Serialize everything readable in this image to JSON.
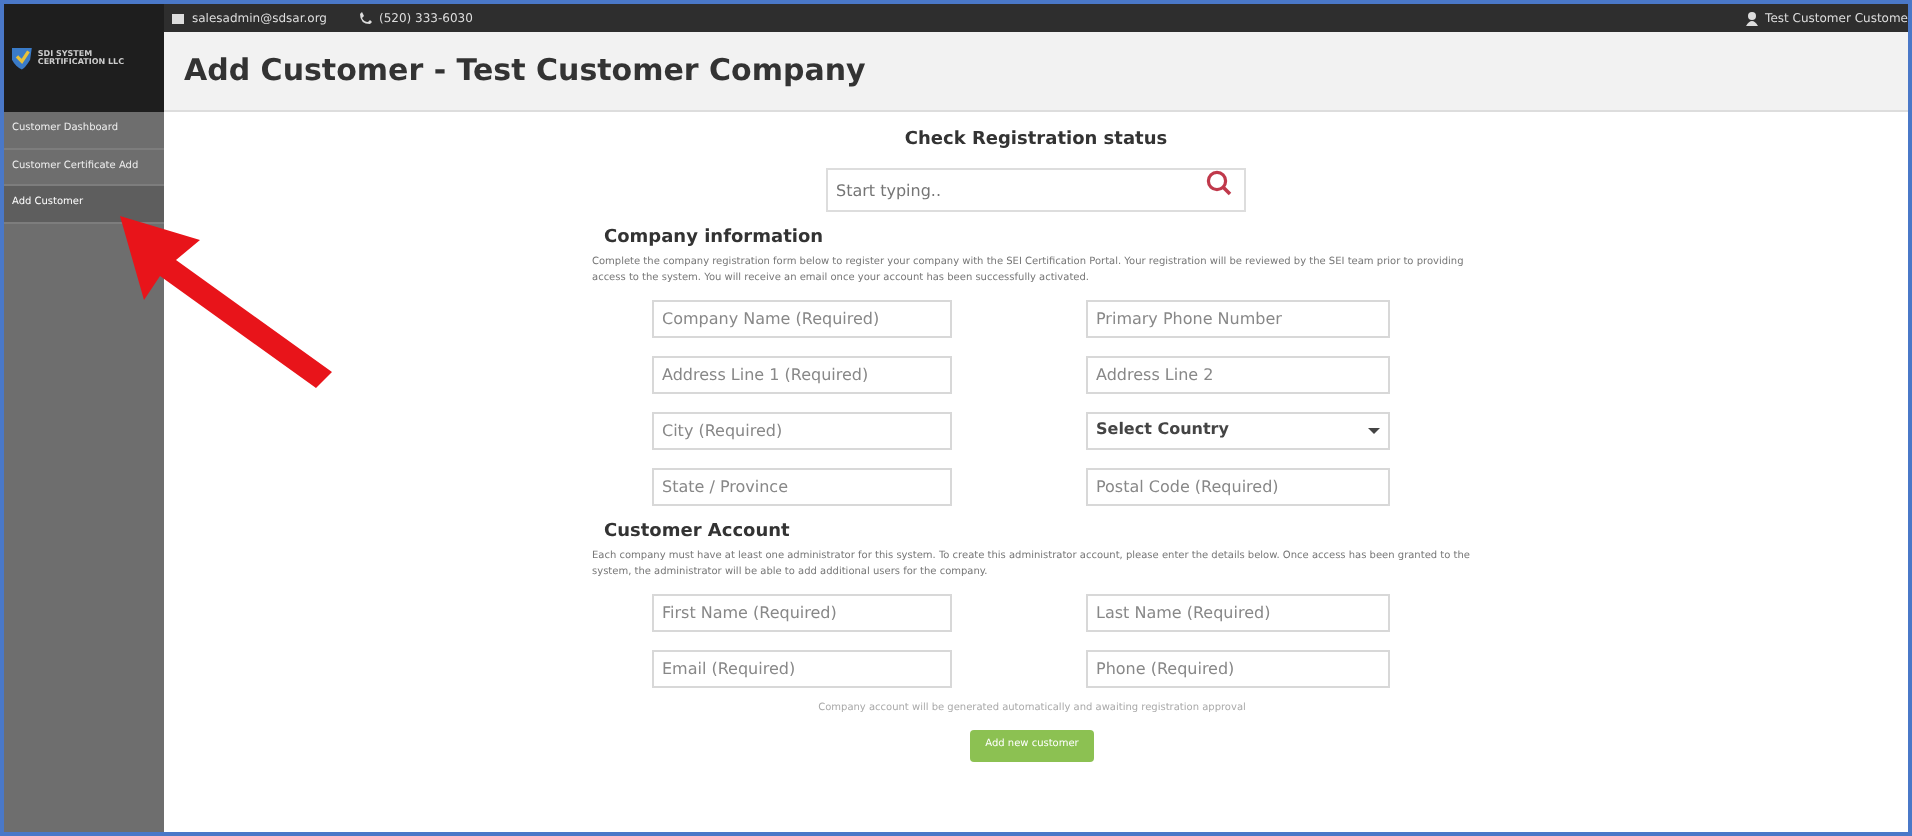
{
  "top_bar": {
    "email": "salesadmin@sdsar.org",
    "phone": "(520) 333-6030",
    "user": "Test Customer Custome"
  },
  "logo": {
    "text": "SDI SYSTEM CERTIFICATION LLC"
  },
  "sidebar": {
    "items": [
      {
        "label": "Customer Dashboard",
        "selected": false
      },
      {
        "label": "Customer Certificate Add",
        "selected": false
      },
      {
        "label": "Add Customer",
        "selected": true
      }
    ]
  },
  "page_title": "Add Customer - Test Customer Company",
  "registration_check": {
    "title": "Check Registration status",
    "placeholder": "Start typing.."
  },
  "sections": [
    {
      "title": "Company information",
      "description": "Complete the company registration form below to register your company with the SEI Certification Portal. Your registration will be reviewed by the SEI team prior to providing access to the system. You will receive an email once your account has been successfully activated.",
      "fields": [
        {
          "kind": "input",
          "placeholder": "Company Name (Required)"
        },
        {
          "kind": "input",
          "placeholder": "Primary Phone Number"
        },
        {
          "kind": "input",
          "placeholder": "Address Line 1 (Required)"
        },
        {
          "kind": "input",
          "placeholder": "Address Line 2"
        },
        {
          "kind": "input",
          "placeholder": "City (Required)"
        },
        {
          "kind": "select",
          "value": "Select Country"
        },
        {
          "kind": "input",
          "placeholder": "State / Province"
        },
        {
          "kind": "input",
          "placeholder": "Postal Code (Required)"
        }
      ]
    },
    {
      "title": "Customer Account",
      "description": "Each company must have at least one administrator for this system. To create this administrator account, please enter the details below. Once access has been granted to the system, the administrator will be able to add additional users for the company.",
      "fields": [
        {
          "kind": "input",
          "placeholder": "First Name (Required)"
        },
        {
          "kind": "input",
          "placeholder": "Last Name (Required)"
        },
        {
          "kind": "input",
          "placeholder": "Email (Required)"
        },
        {
          "kind": "input",
          "placeholder": "Phone (Required)"
        }
      ]
    }
  ],
  "note": "Company account will be generated automatically and awaiting registration approval",
  "submit_button": "Add new customer"
}
